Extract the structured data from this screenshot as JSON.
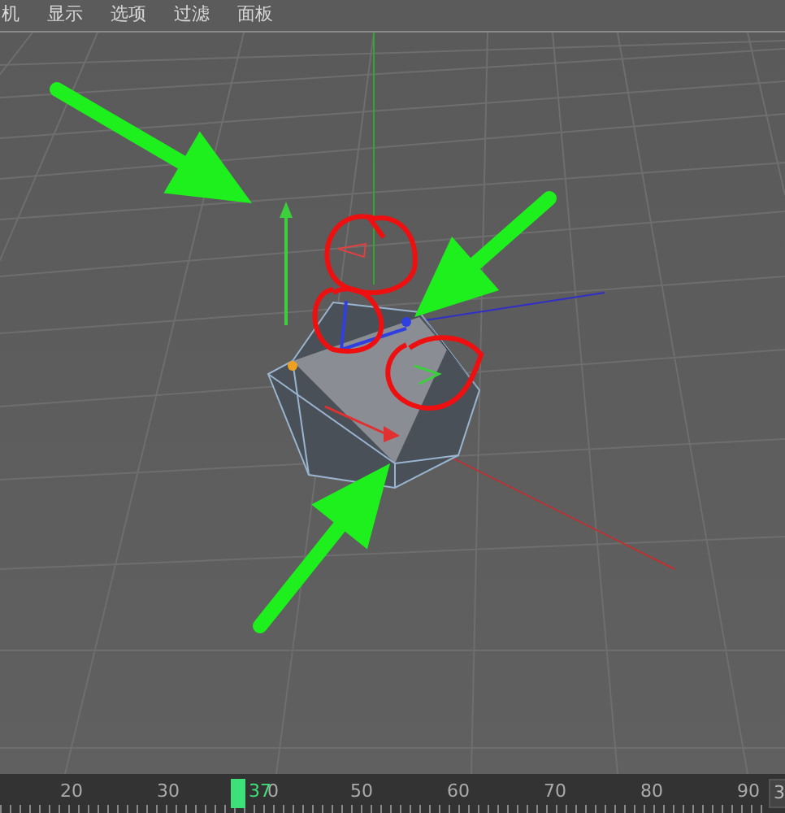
{
  "menu": [
    {
      "label": "机"
    },
    {
      "label": "显示"
    },
    {
      "label": "选项"
    },
    {
      "label": "过滤"
    },
    {
      "label": "面板"
    }
  ],
  "timeline": {
    "ticks": [
      "20",
      "30",
      "0",
      "50",
      "60",
      "70",
      "80",
      "90"
    ],
    "current_frame": "37",
    "end_field": "3"
  }
}
